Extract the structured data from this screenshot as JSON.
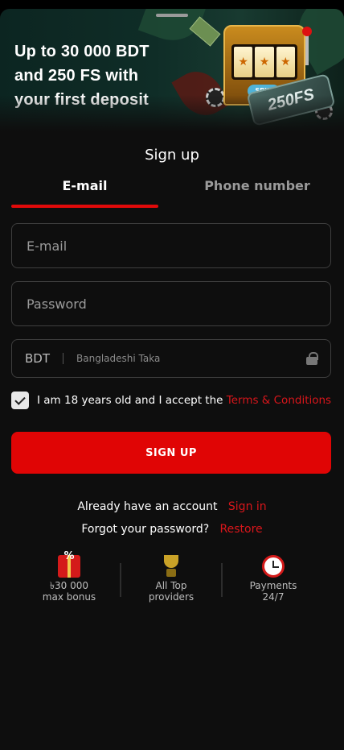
{
  "banner": {
    "title": "Up to 30 000 BDT and 250 FS with your first deposit",
    "fs_badge": "250FS",
    "slot_badge": "SPIN"
  },
  "form": {
    "title": "Sign up",
    "tabs": [
      {
        "label": "E-mail",
        "active": true
      },
      {
        "label": "Phone number",
        "active": false
      }
    ],
    "email_placeholder": "E-mail",
    "password_placeholder": "Password",
    "currency": {
      "code": "BDT",
      "name": "Bangladeshi Taka",
      "icon": "lock-icon"
    },
    "consent": {
      "text": "I am 18 years old and I accept the",
      "link": "Terms & Conditions",
      "checked": true
    },
    "submit_label": "SIGN UP"
  },
  "account": {
    "have_account_text": "Already have an account",
    "sign_in_link": "Sign in",
    "forgot_text": "Forgot your password?",
    "restore_link": "Restore"
  },
  "features": [
    {
      "icon": "gift-icon",
      "line1": "৳30 000",
      "line2": "max bonus"
    },
    {
      "icon": "trophy-icon",
      "line1": "All Top",
      "line2": "providers"
    },
    {
      "icon": "clock-icon",
      "line1": "Payments",
      "line2": "24/7"
    }
  ],
  "colors": {
    "accent": "#e00505",
    "link": "#d9161b",
    "background": "#0e0e0e"
  }
}
